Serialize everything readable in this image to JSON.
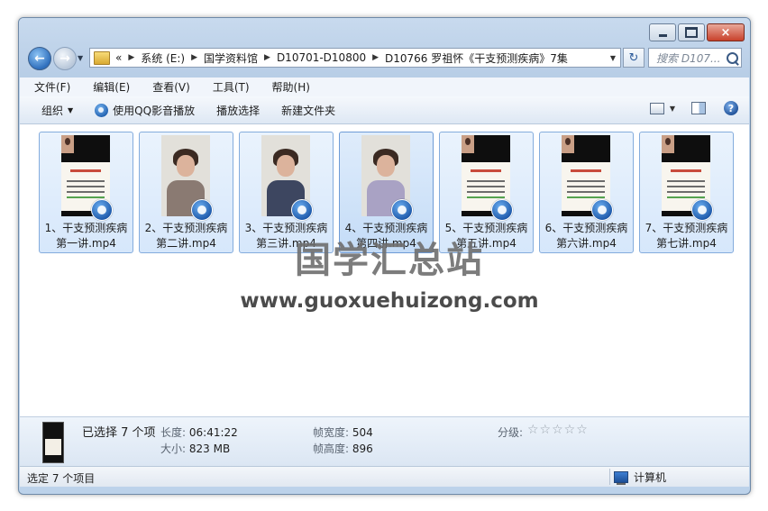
{
  "window": {
    "minimize_label": "",
    "close_label": "×"
  },
  "nav": {
    "address": {
      "overflow": "«",
      "crumbs": [
        "系统 (E:)",
        "国学资料馆",
        "D10701-D10800",
        "D10766 罗祖怀《干支预测疾病》7集"
      ]
    },
    "search_placeholder": "搜索 D107..."
  },
  "menu": [
    "文件(F)",
    "编辑(E)",
    "查看(V)",
    "工具(T)",
    "帮助(H)"
  ],
  "toolbar": {
    "organize": "组织",
    "qq_play": "使用QQ影音播放",
    "play_selection": "播放选择",
    "new_folder": "新建文件夹",
    "help": "?"
  },
  "files": [
    {
      "line1": "1、干支预测疾病",
      "line2": "第一讲.mp4",
      "thumb": "slide"
    },
    {
      "line1": "2、干支预测疾病",
      "line2": "第二讲.mp4",
      "thumb": "person"
    },
    {
      "line1": "3、干支预测疾病",
      "line2": "第三讲.mp4",
      "thumb": "person"
    },
    {
      "line1": "4、干支预测疾病",
      "line2": "第四讲.mp4",
      "thumb": "person"
    },
    {
      "line1": "5、干支预测疾病",
      "line2": "第五讲.mp4",
      "thumb": "slide"
    },
    {
      "line1": "6、干支预测疾病",
      "line2": "第六讲.mp4",
      "thumb": "slide"
    },
    {
      "line1": "7、干支预测疾病",
      "line2": "第七讲.mp4",
      "thumb": "slide"
    }
  ],
  "watermark": {
    "title": "国学汇总站",
    "url": "www.guoxuehuizong.com"
  },
  "details": {
    "selected": "已选择 7 个项",
    "length_label": "长度:",
    "length_value": "06:41:22",
    "size_label": "大小:",
    "size_value": "823 MB",
    "frame_width_label": "帧宽度:",
    "frame_width_value": "504",
    "frame_height_label": "帧高度:",
    "frame_height_value": "896",
    "rating_label": "分级:",
    "rating_stars": "☆☆☆☆☆"
  },
  "status": {
    "left": "选定 7 个项目",
    "right": "计算机"
  }
}
